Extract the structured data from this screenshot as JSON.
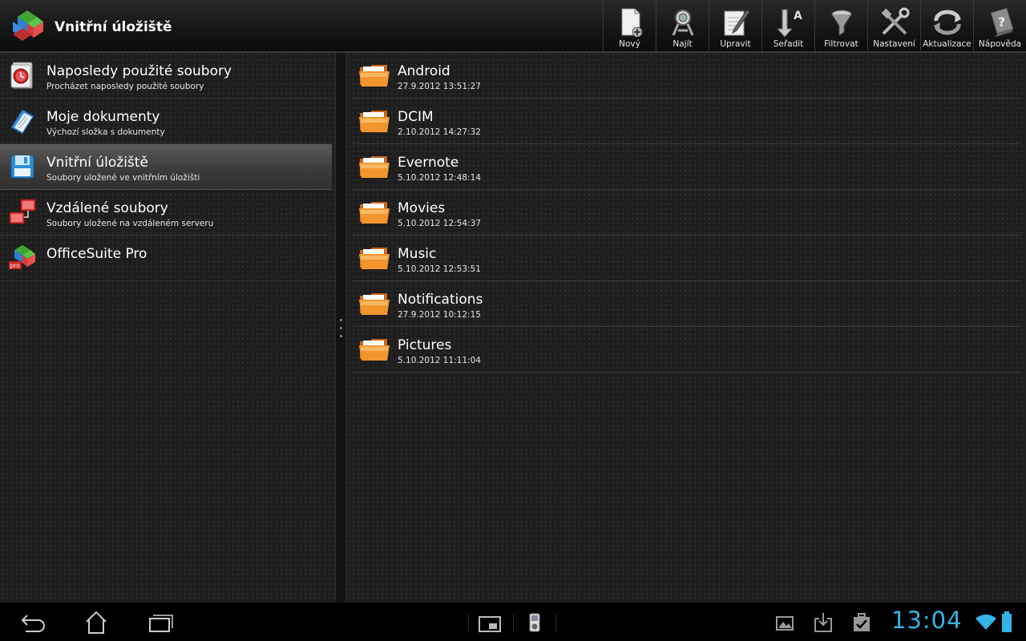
{
  "app": {
    "title": "Vnitřní úložiště"
  },
  "toolbar": {
    "actions": [
      {
        "label": "Nový",
        "icon": "new-document-icon"
      },
      {
        "label": "Najít",
        "icon": "search-binoculars-icon"
      },
      {
        "label": "Upravit",
        "icon": "edit-notepad-icon"
      },
      {
        "label": "Seřadit",
        "icon": "sort-arrow-icon"
      },
      {
        "label": "Filtrovat",
        "icon": "filter-funnel-icon"
      },
      {
        "label": "Nastavení",
        "icon": "settings-tools-icon"
      },
      {
        "label": "Aktualizace",
        "icon": "refresh-icon"
      },
      {
        "label": "Nápověda",
        "icon": "help-book-icon"
      }
    ]
  },
  "sidebar": {
    "items": [
      {
        "title": "Naposledy použité soubory",
        "subtitle": "Procházet naposledy použité soubory",
        "icon": "recent-files-icon"
      },
      {
        "title": "Moje dokumenty",
        "subtitle": "Výchozí složka s dokumenty",
        "icon": "my-documents-icon"
      },
      {
        "title": "Vnitřní úložiště",
        "subtitle": "Soubory uložené ve vnitřním úložišti",
        "icon": "internal-storage-icon",
        "selected": true
      },
      {
        "title": "Vzdálené soubory",
        "subtitle": "Soubory uložené na vzdáleném serveru",
        "icon": "remote-files-icon"
      },
      {
        "title": "OfficeSuite Pro",
        "subtitle": "",
        "icon": "officesuite-pro-icon"
      }
    ]
  },
  "files": [
    {
      "name": "Android",
      "date": "27.9.2012 13:51:27"
    },
    {
      "name": "DCIM",
      "date": "2.10.2012 14:27:32"
    },
    {
      "name": "Evernote",
      "date": "5.10.2012 12:48:14"
    },
    {
      "name": "Movies",
      "date": "5.10.2012 12:54:37"
    },
    {
      "name": "Music",
      "date": "5.10.2012 12:53:51"
    },
    {
      "name": "Notifications",
      "date": "27.9.2012 10:12:15"
    },
    {
      "name": "Pictures",
      "date": "5.10.2012 11:11:04"
    }
  ],
  "system_bar": {
    "clock": "13:04",
    "accent": "#33b5e5"
  }
}
